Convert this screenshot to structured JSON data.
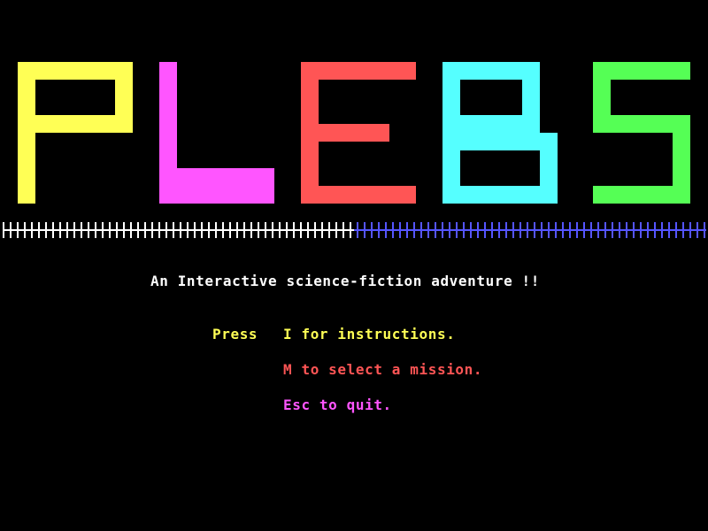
{
  "title": {
    "letters": [
      {
        "char": "P",
        "color": "#ffff55"
      },
      {
        "char": "L",
        "color": "#ff55ff"
      },
      {
        "char": "E",
        "color": "#ff5555"
      },
      {
        "char": "B",
        "color": "#55ffff"
      },
      {
        "char": "S",
        "color": "#55ff55"
      }
    ]
  },
  "ruler": {
    "colors": {
      "left": "#ffffff",
      "right": "#5555ff"
    }
  },
  "tagline": {
    "text": "An Interactive science-fiction adventure !!",
    "color": "#ffffff"
  },
  "menu": {
    "press_label": "Press",
    "press_color": "#ffff55",
    "options": [
      {
        "text": "I for instructions.",
        "color": "#ffff55"
      },
      {
        "text": "M to select a mission.",
        "color": "#ff5555"
      },
      {
        "text": "Esc to quit.",
        "color": "#ff55ff"
      }
    ]
  }
}
